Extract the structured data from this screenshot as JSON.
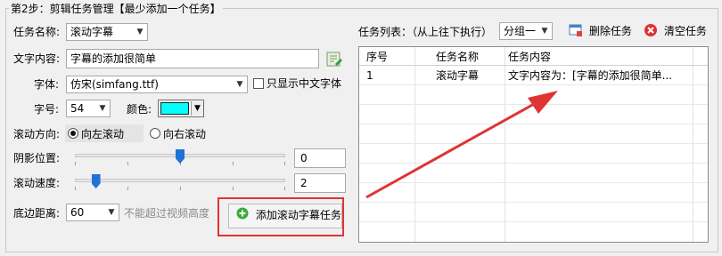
{
  "step_title": "第2步：剪辑任务管理【最少添加一个任务】",
  "task_name": {
    "label": "任务名称:",
    "value": "滚动字幕"
  },
  "text_content": {
    "label": "文字内容:",
    "value": "字幕的添加很简单"
  },
  "font": {
    "label": "字体:",
    "value": "仿宋(simfang.ttf)",
    "cn_only_label": "只显示中文字体"
  },
  "font_size": {
    "label": "字号:",
    "value": "54"
  },
  "color": {
    "label": "颜色:",
    "swatch": "#00ffff"
  },
  "scroll_dir": {
    "label": "滚动方向:",
    "left_label": "向左滚动",
    "right_label": "向右滚动",
    "selected": "left"
  },
  "shadow": {
    "label": "阴影位置:",
    "value": "0",
    "level": 0.5
  },
  "speed": {
    "label": "滚动速度:",
    "value": "2",
    "level": 0.1
  },
  "bottom": {
    "label": "底边距离:",
    "value": "60",
    "hint": "不能超过视频高度"
  },
  "add_button": {
    "label": "添加滚动字幕任务"
  },
  "task_list": {
    "label": "任务列表：（从上往下执行）",
    "group_value": "分组一",
    "delete_label": "删除任务",
    "clear_label": "清空任务",
    "columns": [
      "序号",
      "任务名称",
      "任务内容"
    ],
    "rows": [
      {
        "index": "1",
        "name": "滚动字幕",
        "content": "文字内容为：[字幕的添加很简单..."
      }
    ]
  },
  "colors": {
    "highlight": "#e03333",
    "accent": "#1c73d8"
  }
}
